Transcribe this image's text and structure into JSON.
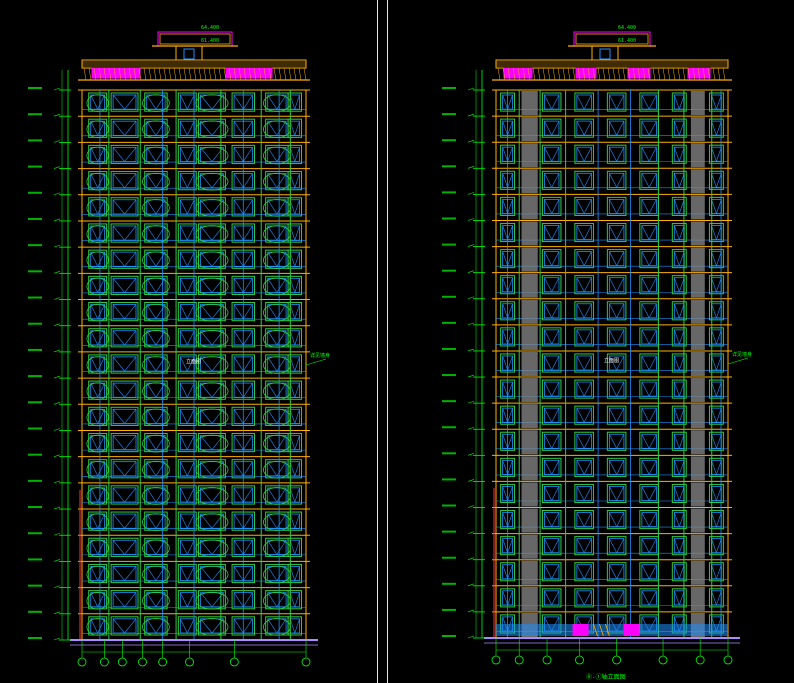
{
  "drawing": {
    "background": "#000000",
    "colors": {
      "frame": "#ffb000",
      "window": "#2ecc40",
      "glass": "#1e90ff",
      "magenta": "#ff00ff",
      "dimension": "#00ff00",
      "divider": "#ffffff",
      "ground": "#b088ff",
      "stair": "#8a8a8a",
      "redline": "#ff3030"
    }
  },
  "left_view": {
    "floor_count": 21,
    "roof_level": "64.400",
    "parapet_level": "61.400",
    "center_note": "立面图",
    "right_note": "详见墙身"
  },
  "right_view": {
    "floor_count": 21,
    "roof_level": "64.400",
    "parapet_level": "61.400",
    "center_note": "立面图",
    "right_note": "详见墙身",
    "caption": "⑧-①轴立面图"
  }
}
